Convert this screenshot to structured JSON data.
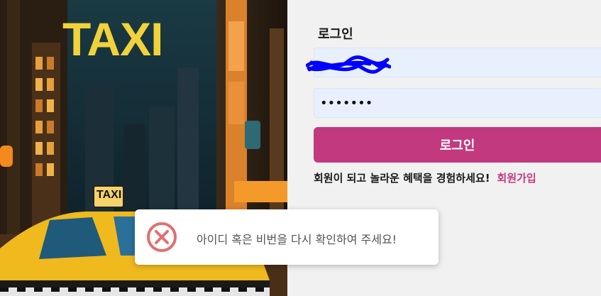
{
  "hero": {
    "sign_text": "TAXI",
    "roof_sign_text": "TAXI"
  },
  "login": {
    "title": "로그인",
    "id_value": "",
    "password_value": "•••••••",
    "submit_label": "로그인",
    "signup_prompt": "회원이 되고 놀라운 혜택을 경험하세요!",
    "signup_link": "회원가입"
  },
  "toast": {
    "icon": "error-x-circle-icon",
    "message": "아이디 혹은 비번을 다시 확인하여 주세요!"
  },
  "colors": {
    "accent": "#c2397f",
    "input_bg": "#e8f0fe",
    "error": "#e07070",
    "scribble": "#0000ff"
  }
}
